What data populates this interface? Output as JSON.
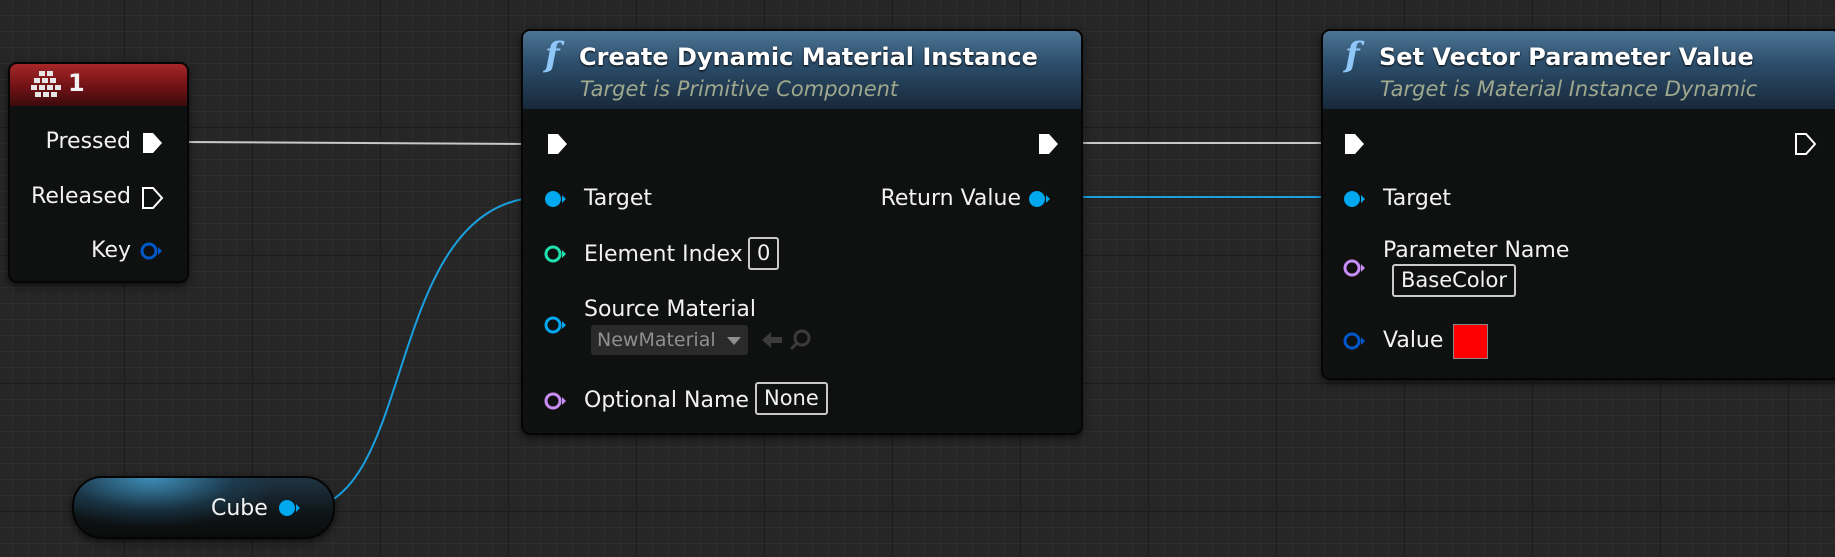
{
  "colors": {
    "exec_pin": "#ffffff",
    "object_pin": "#00a8f0",
    "int_pin": "#1fe3af",
    "name_pin": "#c98df6",
    "struct_pin": "#0058c9",
    "link_color": "#1aa0e0",
    "exec_wire": "#c8c8c8"
  },
  "input_event_node": {
    "icon": "keyboard-icon",
    "title": "1",
    "pins": {
      "pressed": "Pressed",
      "released": "Released",
      "key": "Key"
    }
  },
  "create_node": {
    "icon": "function-icon",
    "title": "Create Dynamic Material Instance",
    "subtitle": "Target is Primitive Component",
    "pins": {
      "target": "Target",
      "return_value": "Return Value",
      "element_index": "Element Index",
      "element_index_value": "0",
      "source_material": "Source Material",
      "source_material_value": "NewMaterial",
      "optional_name": "Optional Name",
      "optional_name_value": "None"
    }
  },
  "set_vector_node": {
    "icon": "function-icon",
    "title": "Set Vector Parameter Value",
    "subtitle": "Target is Material Instance Dynamic",
    "pins": {
      "target": "Target",
      "parameter_name": "Parameter Name",
      "parameter_name_value": "BaseColor",
      "value": "Value",
      "value_color": "#ff0000"
    }
  },
  "cube_variable": {
    "label": "Cube"
  }
}
